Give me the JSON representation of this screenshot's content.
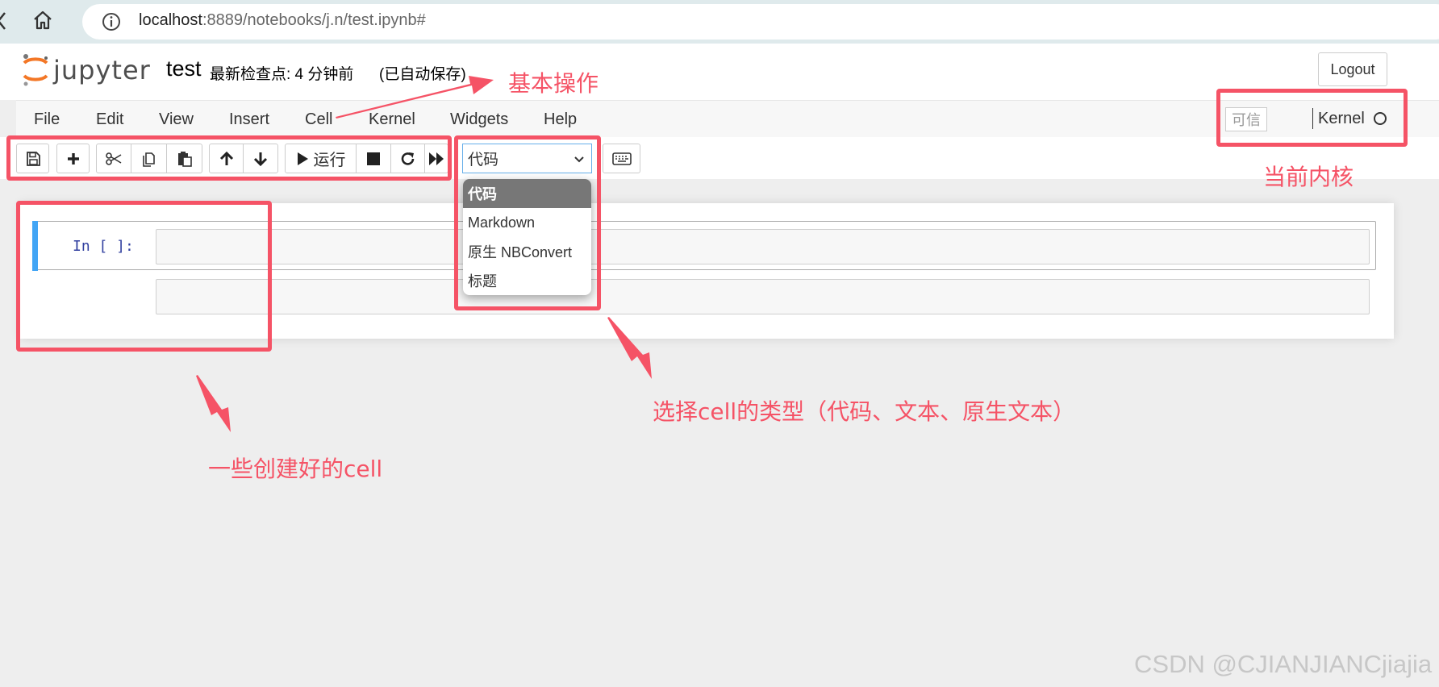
{
  "browser": {
    "url_host": "localhost",
    "url_path": ":8889/notebooks/j.n/test.ipynb#"
  },
  "header": {
    "logo": "jupyter",
    "notebook_title": "test",
    "checkpoint": "最新检查点: 4 分钟前",
    "autosave": "(已自动保存)",
    "logout_label": "Logout"
  },
  "menubar": {
    "items": [
      "File",
      "Edit",
      "View",
      "Insert",
      "Cell",
      "Kernel",
      "Widgets",
      "Help"
    ],
    "trusted_label": "可信",
    "kernel_name": "Kernel"
  },
  "toolbar": {
    "run_label": "运行",
    "cell_type_selected": "代码",
    "cell_type_options": [
      "代码",
      "Markdown",
      "原生 NBConvert",
      "标题"
    ]
  },
  "notebook": {
    "prompt": "In [ ]:"
  },
  "annotations": {
    "basic_ops": "基本操作",
    "current_kernel": "当前内核",
    "cell_type_note": "选择cell的类型（代码、文本、原生文本）",
    "cells_note": "一些创建好的cell"
  },
  "watermark": "CSDN @CJIANJIANCjiajia",
  "colors": {
    "annotation": "#f55366",
    "cell_selected_bar": "#42a5f5",
    "jupyter_orange": "#f37726"
  }
}
